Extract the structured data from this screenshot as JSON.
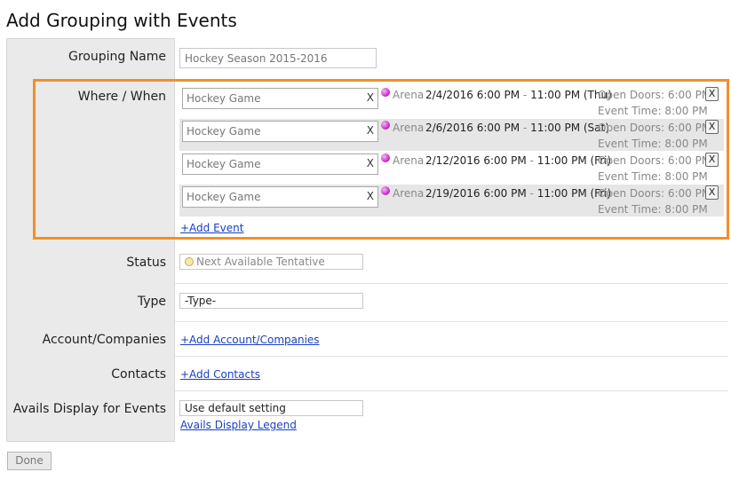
{
  "page_title": "Add Grouping with Events",
  "labels": {
    "grouping_name": "Grouping Name",
    "where_when": "Where / When",
    "status": "Status",
    "type": "Type",
    "accounts": "Account/Companies",
    "contacts": "Contacts",
    "avails": "Avails Display for Events"
  },
  "grouping_name_value": "Hockey Season 2015-2016",
  "events": [
    {
      "name": "Hockey Game",
      "remove_x": "X",
      "venue": "Arena",
      "start": "2/4/2016 6:00 PM",
      "dash": "-",
      "end": "11:00 PM (Thu)",
      "open_doors": "Open Doors: 6:00 PM",
      "event_time": "Event Time: 8:00 PM",
      "delete": "X"
    },
    {
      "name": "Hockey Game",
      "remove_x": "X",
      "venue": "Arena",
      "start": "2/6/2016 6:00 PM",
      "dash": "-",
      "end": "11:00 PM (Sat)",
      "open_doors": "Open Doors: 6:00 PM",
      "event_time": "Event Time: 8:00 PM",
      "delete": "X"
    },
    {
      "name": "Hockey Game",
      "remove_x": "X",
      "venue": "Arena",
      "start": "2/12/2016 6:00 PM",
      "dash": "-",
      "end": "11:00 PM (Fri)",
      "open_doors": "Open Doors: 6:00 PM",
      "event_time": "Event Time: 8:00 PM",
      "delete": "X"
    },
    {
      "name": "Hockey Game",
      "remove_x": "X",
      "venue": "Arena",
      "start": "2/19/2016 6:00 PM",
      "dash": "-",
      "end": "11:00 PM (Fri)",
      "open_doors": "Open Doors: 6:00 PM",
      "event_time": "Event Time: 8:00 PM",
      "delete": "X"
    }
  ],
  "add_event": "+Add Event",
  "status_value": "Next Available Tentative",
  "type_value": "-Type-",
  "add_accounts": "+Add Account/Companies",
  "add_contacts": "+Add Contacts",
  "avails_value": "Use default setting",
  "avails_legend": "Avails Display Legend",
  "done_label": "Done",
  "colors": {
    "highlight": "#f0902a",
    "link": "#1a3fc2",
    "event_dot": "#c828c8"
  }
}
